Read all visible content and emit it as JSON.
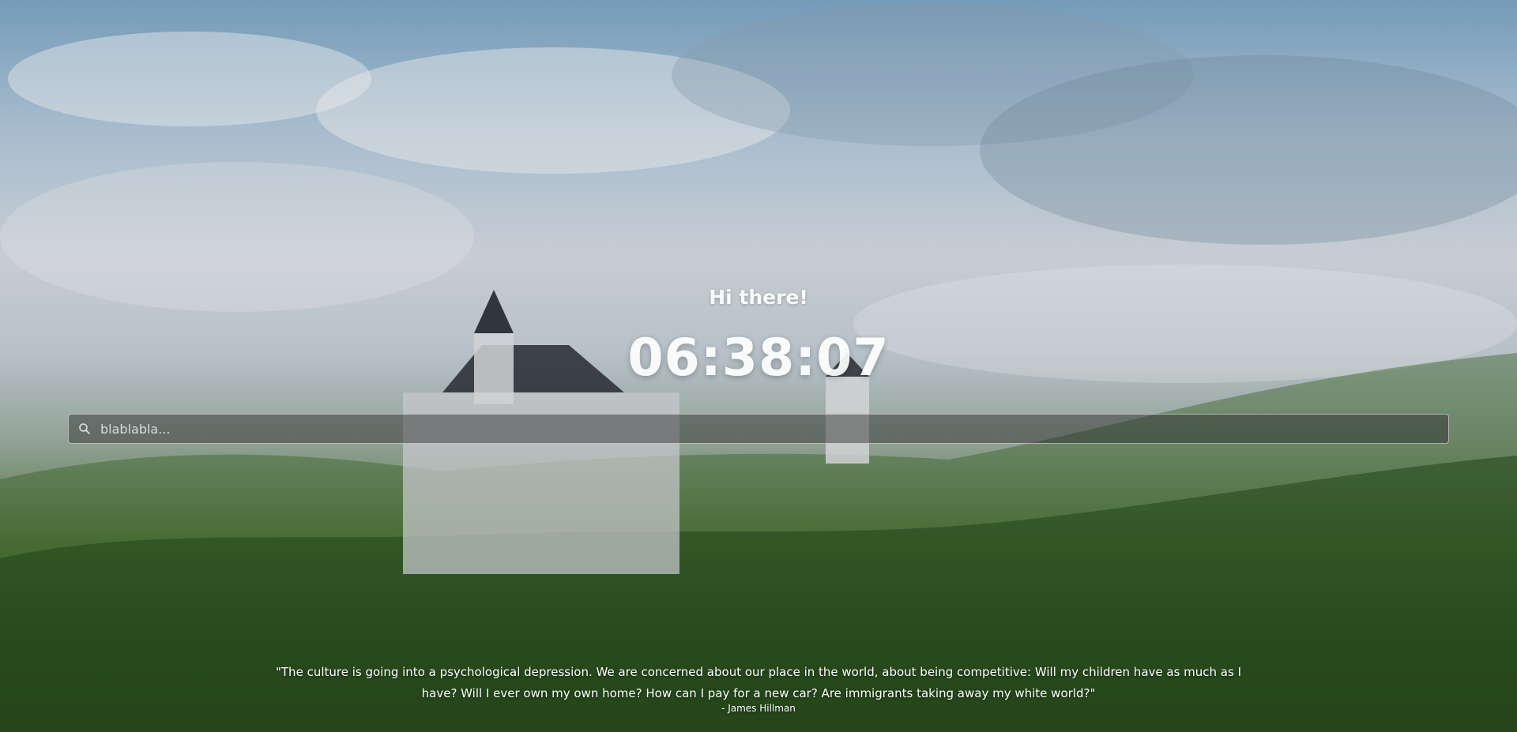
{
  "greeting": "Hi there!",
  "clock": "06:38:07",
  "search": {
    "placeholder": "blablabla...",
    "value": ""
  },
  "quote": {
    "text": "\"The culture is going into a psychological depression. We are concerned about our place in the world, about being competitive: Will my children have as much as I have? Will I ever own my own home? How can I pay for a new car? Are immigrants taking away my white world?\"",
    "author": "- James Hillman"
  },
  "icons": {
    "search": "search-icon"
  },
  "colors": {
    "text": "#ffffff",
    "search_bg": "#282828"
  }
}
